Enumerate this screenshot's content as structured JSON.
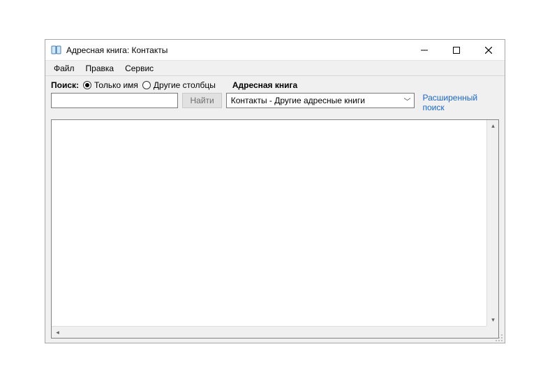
{
  "window": {
    "title": "Адресная книга: Контакты"
  },
  "menu": {
    "file": "Файл",
    "edit": "Правка",
    "service": "Сервис"
  },
  "search": {
    "label": "Поиск:",
    "radio_name_only": "Только имя",
    "radio_other_cols": "Другие столбцы",
    "selected_radio": "name_only",
    "input_value": "",
    "find_button": "Найти"
  },
  "addressbook": {
    "label": "Адресная книга",
    "dropdown_value": "Контакты - Другие адресные книги"
  },
  "advanced_link": "Расширенный поиск"
}
